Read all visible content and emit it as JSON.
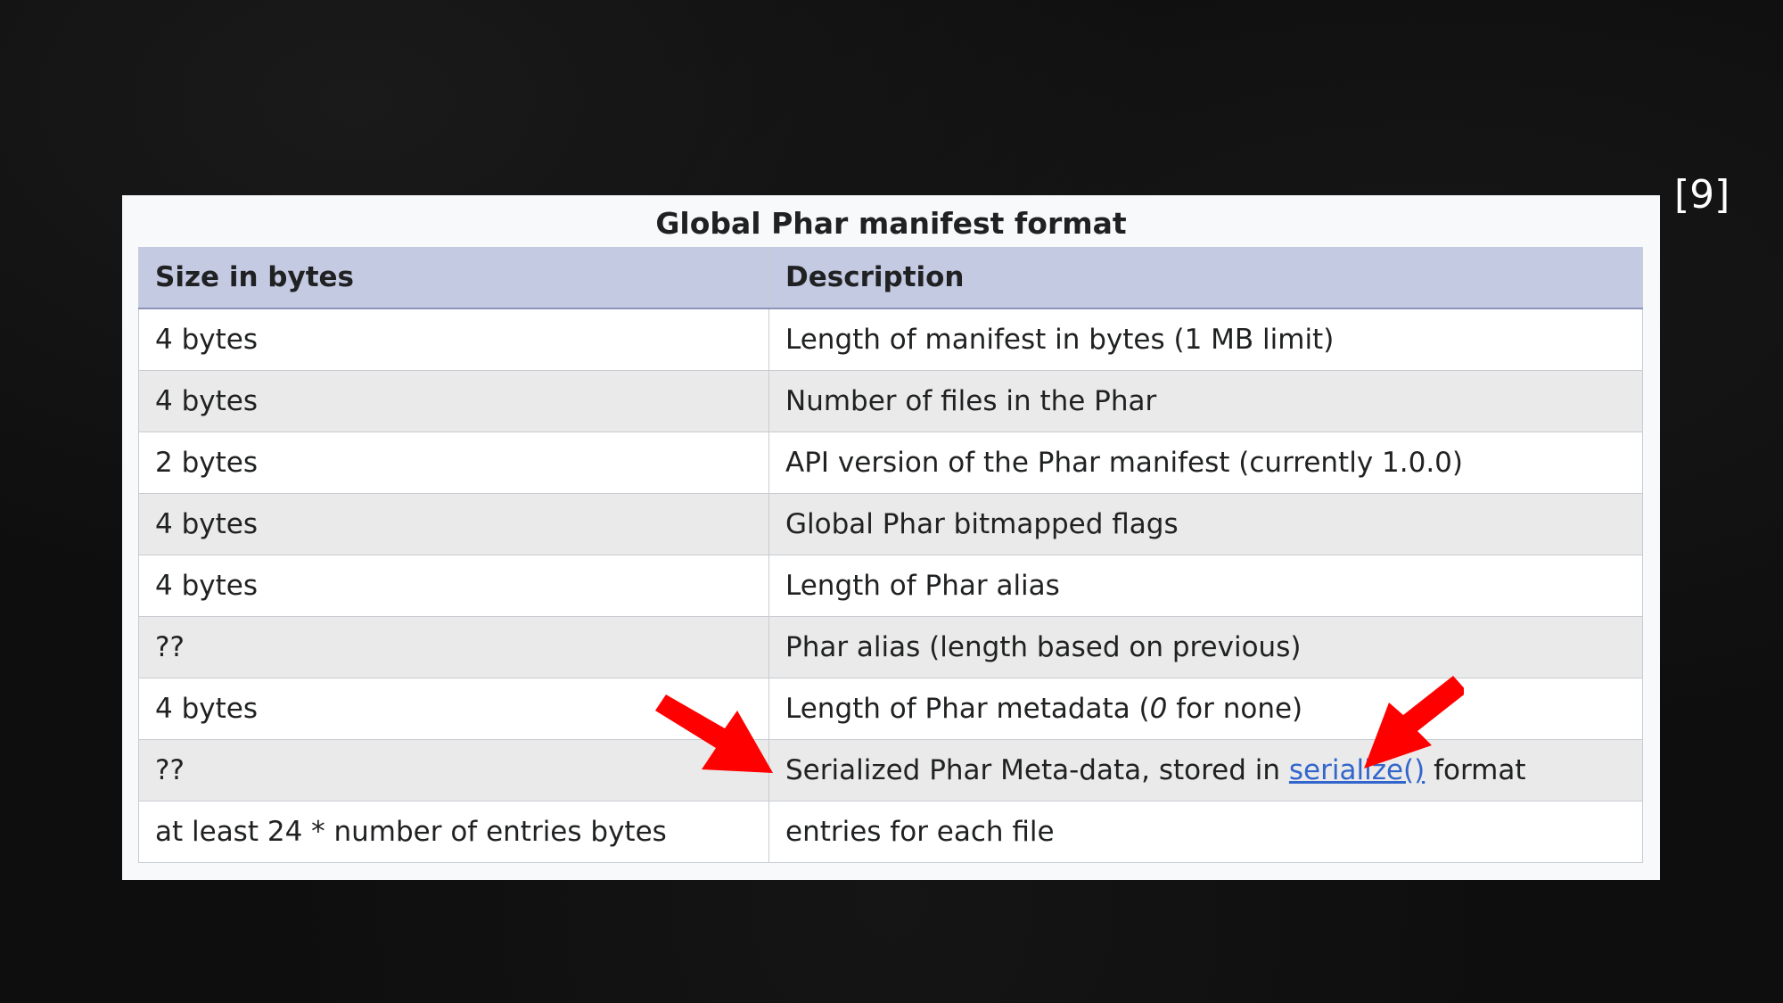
{
  "footnote": "[9]",
  "table": {
    "caption": "Global Phar manifest format",
    "headers": {
      "size": "Size in bytes",
      "description": "Description"
    },
    "rows": [
      {
        "size": "4 bytes",
        "description": "Length of manifest in bytes (1 MB limit)"
      },
      {
        "size": "4 bytes",
        "description": "Number of files in the Phar"
      },
      {
        "size": "2 bytes",
        "description": "API version of the Phar manifest (currently 1.0.0)"
      },
      {
        "size": "4 bytes",
        "description": "Global Phar bitmapped flags"
      },
      {
        "size": "4 bytes",
        "description": "Length of Phar alias"
      },
      {
        "size": "??",
        "description": "Phar alias (length based on previous)"
      },
      {
        "size": "4 bytes",
        "desc_before": "Length of Phar metadata (",
        "desc_italic": "0",
        "desc_after": " for none)"
      },
      {
        "size": "??",
        "desc_before": "Serialized Phar Meta-data, stored in ",
        "desc_link": "serialize()",
        "desc_after": " format"
      },
      {
        "size": "at least 24 * number of entries bytes",
        "description": "entries for each file"
      }
    ]
  },
  "colors": {
    "header_bg": "#c5cae3",
    "link": "#3366cc",
    "annotation_arrow": "#ff0000"
  },
  "icons": [
    "red-annotation-arrow-left",
    "red-annotation-arrow-right"
  ]
}
